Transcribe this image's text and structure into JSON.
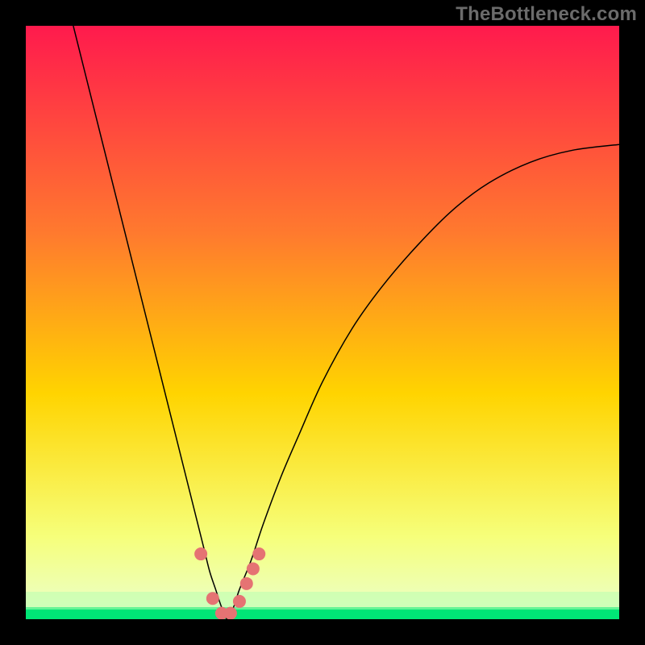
{
  "watermark": "TheBottleneck.com",
  "chart_data": {
    "type": "line",
    "title": "",
    "xlabel": "",
    "ylabel": "",
    "xlim": [
      0,
      100
    ],
    "ylim": [
      0,
      100
    ],
    "grid": false,
    "legend": false,
    "background_gradient": {
      "top_color": "#ff1a4d",
      "mid_color": "#ffd400",
      "bottom_band_color": "#00e676",
      "bottom_band_height_fraction": 0.02
    },
    "series": [
      {
        "name": "bottleneck-curve",
        "color": "#000000",
        "stroke_width": 1.5,
        "x": [
          8,
          10,
          12,
          14,
          16,
          18,
          20,
          22,
          24,
          26,
          28,
          30,
          31,
          32,
          33,
          34,
          35,
          36,
          38,
          40,
          43,
          46,
          50,
          55,
          60,
          66,
          72,
          78,
          85,
          92,
          100
        ],
        "values": [
          100,
          92,
          84,
          76,
          68,
          60,
          52,
          44,
          36,
          28,
          20,
          12,
          8,
          5,
          2,
          0,
          2,
          5,
          10,
          16,
          24,
          31,
          40,
          49,
          56,
          63,
          69,
          73.5,
          77,
          79,
          80
        ]
      }
    ],
    "markers": {
      "name": "highlight-points",
      "color": "#e57373",
      "radius": 8,
      "x": [
        29.5,
        31.5,
        33,
        34.5,
        36,
        37.2,
        38.3,
        39.3
      ],
      "values": [
        11,
        3.5,
        1,
        1,
        3,
        6,
        8.5,
        11
      ]
    }
  }
}
